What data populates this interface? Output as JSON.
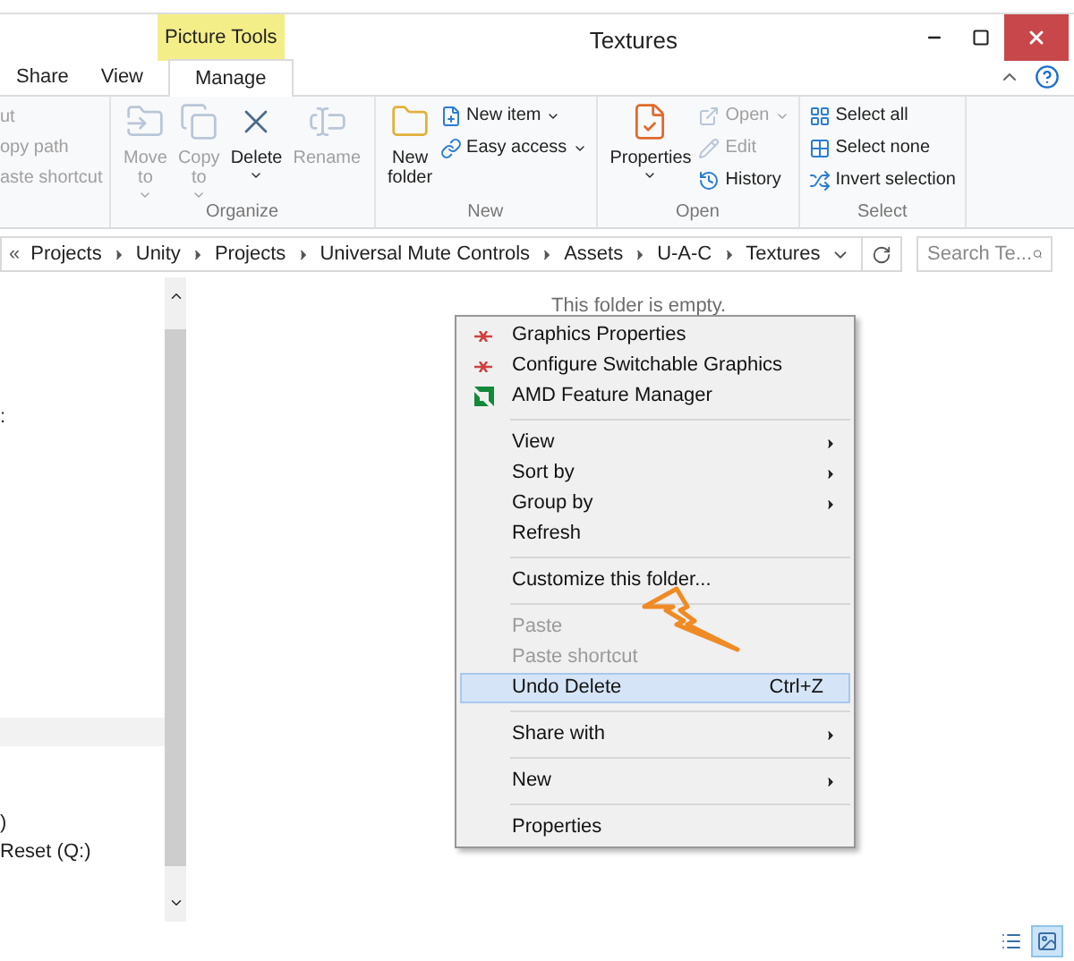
{
  "window": {
    "title": "Textures",
    "context_label": "Picture Tools"
  },
  "tabs": [
    {
      "label": "Share",
      "selected": false
    },
    {
      "label": "View",
      "selected": false
    },
    {
      "label": "Manage",
      "selected": true
    }
  ],
  "clipboard_items": [
    {
      "label": "ut",
      "disabled": true
    },
    {
      "label": "opy path",
      "disabled": true
    },
    {
      "label": "aste shortcut",
      "disabled": true
    }
  ],
  "groups": [
    {
      "name": "Organize",
      "buttons": [
        {
          "kind": "large",
          "label": "Move",
          "label2": "to",
          "dropdown": true,
          "disabled": true
        },
        {
          "kind": "large",
          "label": "Copy",
          "label2": "to",
          "dropdown": true,
          "disabled": true
        },
        {
          "kind": "large",
          "label": "Delete",
          "dropdown": true,
          "disabled": false
        },
        {
          "kind": "large",
          "label": "Rename",
          "dropdown": false,
          "disabled": true
        }
      ]
    },
    {
      "name": "New",
      "buttons": [
        {
          "kind": "large",
          "label": "New",
          "label2": "folder",
          "dropdown": false,
          "disabled": false
        },
        {
          "kind": "small",
          "label": "New item",
          "dropdown": true,
          "disabled": false
        },
        {
          "kind": "small",
          "label": "Easy access",
          "dropdown": true,
          "disabled": false
        }
      ]
    },
    {
      "name": "Open",
      "buttons": [
        {
          "kind": "large",
          "label": "Properties",
          "dropdown": true,
          "disabled": false
        },
        {
          "kind": "small",
          "label": "Open",
          "dropdown": true,
          "disabled": true
        },
        {
          "kind": "small",
          "label": "Edit",
          "dropdown": false,
          "disabled": true
        },
        {
          "kind": "small",
          "label": "History",
          "dropdown": false,
          "disabled": false
        }
      ]
    },
    {
      "name": "Select",
      "buttons": [
        {
          "kind": "small",
          "label": "Select all",
          "dropdown": false,
          "disabled": false
        },
        {
          "kind": "small",
          "label": "Select none",
          "dropdown": false,
          "disabled": false
        },
        {
          "kind": "small",
          "label": "Invert selection",
          "dropdown": false,
          "disabled": false
        }
      ]
    }
  ],
  "address": {
    "overflow": "«",
    "crumbs": [
      "Projects",
      "Unity",
      "Projects",
      "Universal Mute Controls",
      "Assets",
      "U-A-C",
      "Textures"
    ]
  },
  "search": {
    "placeholder": "Search Te..."
  },
  "nav_texts": [
    ":",
    ")",
    "Reset (Q:)"
  ],
  "empty_message": "This folder is empty.",
  "context_menu": [
    {
      "kind": "item",
      "label": "Graphics Properties",
      "submenu": false,
      "disabled": false,
      "selected": false
    },
    {
      "kind": "item",
      "label": "Configure Switchable Graphics",
      "submenu": false,
      "disabled": false,
      "selected": false
    },
    {
      "kind": "item",
      "label": "AMD Feature Manager",
      "submenu": false,
      "disabled": false,
      "selected": false
    },
    {
      "kind": "separator"
    },
    {
      "kind": "item",
      "label": "View",
      "submenu": true,
      "disabled": false,
      "selected": false
    },
    {
      "kind": "item",
      "label": "Sort by",
      "submenu": true,
      "disabled": false,
      "selected": false
    },
    {
      "kind": "item",
      "label": "Group by",
      "submenu": true,
      "disabled": false,
      "selected": false
    },
    {
      "kind": "item",
      "label": "Refresh",
      "submenu": false,
      "disabled": false,
      "selected": false
    },
    {
      "kind": "separator"
    },
    {
      "kind": "item",
      "label": "Customize this folder...",
      "submenu": false,
      "disabled": false,
      "selected": false
    },
    {
      "kind": "separator"
    },
    {
      "kind": "item",
      "label": "Paste",
      "submenu": false,
      "disabled": true,
      "selected": false
    },
    {
      "kind": "item",
      "label": "Paste shortcut",
      "submenu": false,
      "disabled": true,
      "selected": false
    },
    {
      "kind": "item",
      "label": "Undo Delete",
      "shortcut": "Ctrl+Z",
      "submenu": false,
      "disabled": false,
      "selected": true
    },
    {
      "kind": "separator"
    },
    {
      "kind": "item",
      "label": "Share with",
      "submenu": true,
      "disabled": false,
      "selected": false
    },
    {
      "kind": "separator"
    },
    {
      "kind": "item",
      "label": "New",
      "submenu": true,
      "disabled": false,
      "selected": false
    },
    {
      "kind": "separator"
    },
    {
      "kind": "item",
      "label": "Properties",
      "submenu": false,
      "disabled": false,
      "selected": false
    }
  ],
  "view_buttons": [
    {
      "kind": "details",
      "selected": false
    },
    {
      "kind": "large",
      "selected": true
    }
  ]
}
